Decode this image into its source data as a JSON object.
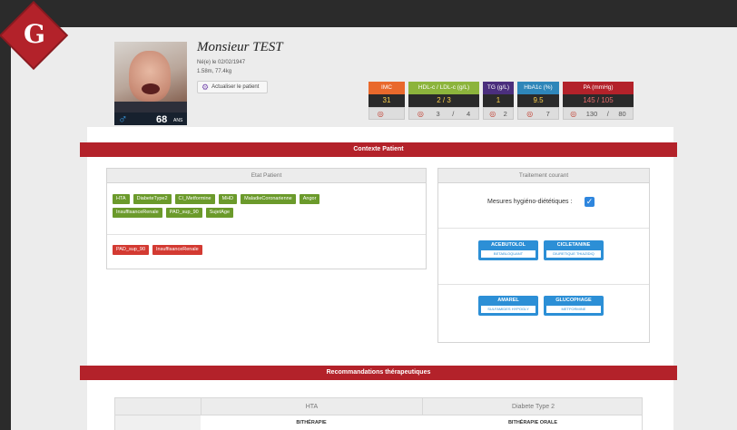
{
  "app": {
    "logo_letter": "G"
  },
  "patient": {
    "name": "Monsieur TEST",
    "born": "Né(e) le 02/02/1947",
    "stats": "1.58m, 77.4kg",
    "age": "68",
    "age_unit": "ANS",
    "gender_icon": "male-icon",
    "update_label": "Actualiser le patient"
  },
  "metrics": [
    {
      "label": "IMC",
      "value": "31",
      "target": [
        "",
        ""
      ],
      "color": "#e9692c"
    },
    {
      "label": "HDL-c / LDL-c (g/L)",
      "value": "2 / 3",
      "target": [
        "3",
        "/",
        "4"
      ],
      "color": "#8cb43c"
    },
    {
      "label": "TG (g/L)",
      "value": "1",
      "target": [
        "2"
      ],
      "color": "#4b2f7d"
    },
    {
      "label": "HbA1c (%)",
      "value": "9.5",
      "target": [
        "7"
      ],
      "color": "#2e86b9"
    },
    {
      "label": "PA (mmHg)",
      "value": "145 / 105",
      "target": [
        "130",
        "/",
        "80"
      ],
      "color": "#b3222a"
    }
  ],
  "context": {
    "title": "Contexte Patient",
    "etat": {
      "title": "Etat Patient",
      "tags_green": [
        "HTA",
        "DiabeteType2",
        "CI_Metformine",
        "MHD",
        "MaladieCoronarienne",
        "Angor",
        "InsuffisanceRenale",
        "PAD_sup_90",
        "SujetAge"
      ],
      "tags_red": [
        "PAD_sup_90",
        "InsuffisanceRenale"
      ]
    },
    "traitement": {
      "title": "Traitement courant",
      "mhd_label": "Mesures hygiéno-diététiques :",
      "mhd_checked": true,
      "drugs": [
        {
          "name": "ACEBUTOLOL",
          "class": "BETABLOQUANT"
        },
        {
          "name": "CICLETANINE",
          "class": "DIURETIQUE THIAZIDIQ"
        },
        {
          "name": "AMAREL",
          "class": "SULFAMIDES HYPOGLY"
        },
        {
          "name": "GLUCOPHAGE",
          "class": "METFORMINE"
        }
      ]
    }
  },
  "recommendations": {
    "title": "Recommandations thérapeutiques",
    "columns": [
      "",
      "HTA",
      "Diabete Type 2"
    ],
    "row": [
      "",
      "BITHÉRAPIE",
      "BITHÉRAPIE ORALE"
    ]
  },
  "colors": {
    "brand_red": "#b3222a",
    "dark": "#2b2b2b",
    "tag_green": "#6b9a2b",
    "tag_red": "#d33a32",
    "drug_blue": "#2c8fd6"
  }
}
